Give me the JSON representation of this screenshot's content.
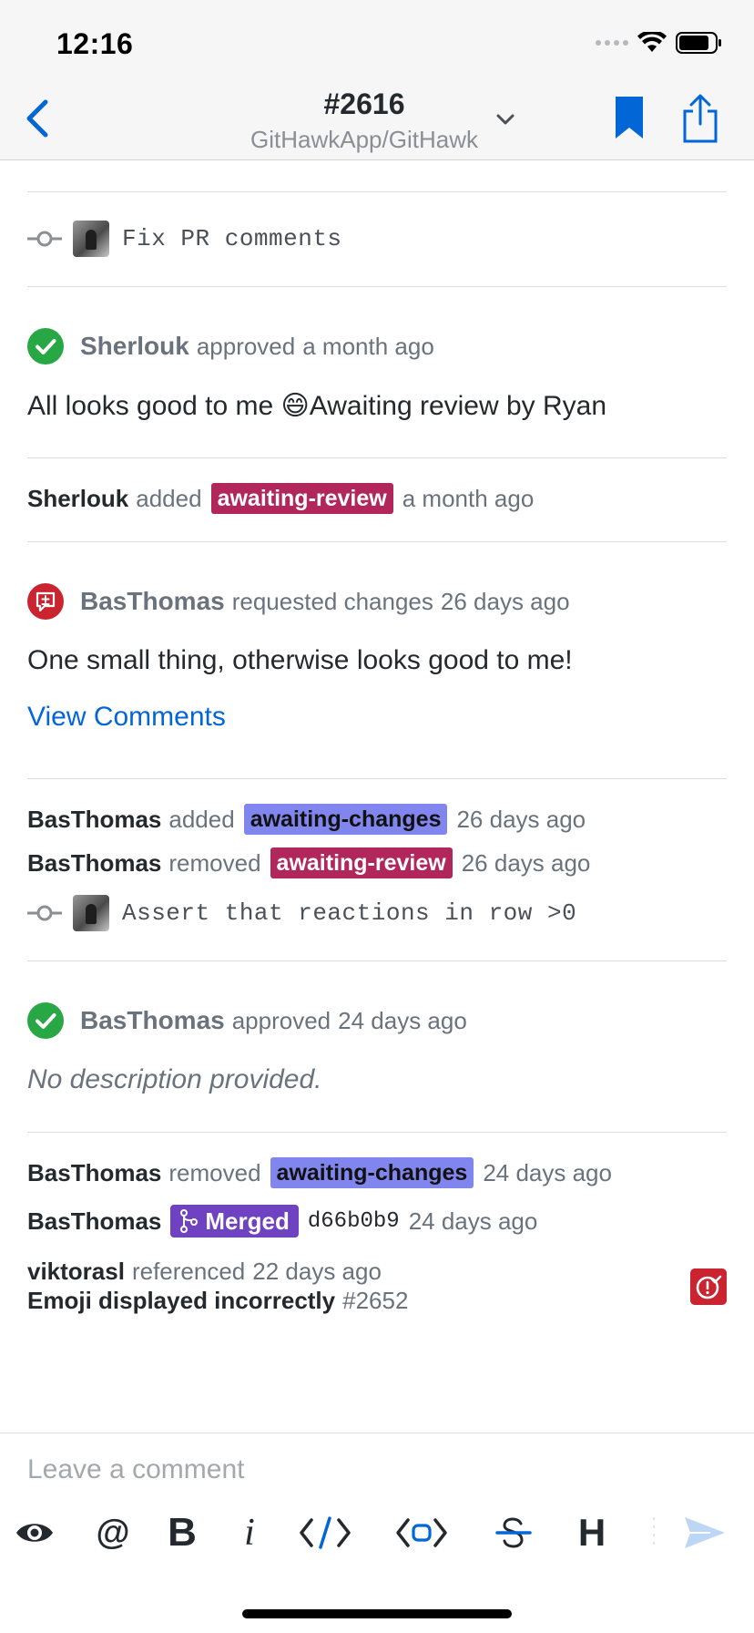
{
  "status_bar": {
    "time": "12:16"
  },
  "nav": {
    "title": "#2616",
    "subtitle": "GitHawkApp/GitHawk"
  },
  "feed": {
    "commit1": {
      "message": "Fix PR comments"
    },
    "review1": {
      "user": "Sherlouk",
      "action": "approved",
      "time": "a month ago",
      "body_before": "All looks good to me",
      "emoji": "😄",
      "body_after": "Awaiting review by Ryan"
    },
    "label_event1": {
      "user": "Sherlouk",
      "action": "added",
      "label": "awaiting-review",
      "time": "a month ago"
    },
    "review2": {
      "user": "BasThomas",
      "action": "requested changes",
      "time": "26 days ago",
      "body": "One small thing, otherwise looks good to me!",
      "link": "View Comments"
    },
    "label_event2": {
      "user": "BasThomas",
      "action": "added",
      "label": "awaiting-changes",
      "time": "26 days ago"
    },
    "label_event3": {
      "user": "BasThomas",
      "action": "removed",
      "label": "awaiting-review",
      "time": "26 days ago"
    },
    "commit2": {
      "message": "Assert that reactions in row >0"
    },
    "review3": {
      "user": "BasThomas",
      "action": "approved",
      "time": "24 days ago",
      "body": "No description provided."
    },
    "label_event4": {
      "user": "BasThomas",
      "action": "removed",
      "label": "awaiting-changes",
      "time": "24 days ago"
    },
    "merge_event": {
      "user": "BasThomas",
      "badge": "Merged",
      "sha": "d66b0b9",
      "time": "24 days ago"
    },
    "reference_event": {
      "user": "viktorasl",
      "action": "referenced",
      "time": "22 days ago",
      "issue_title": "Emoji displayed incorrectly",
      "issue_number": "#2652"
    }
  },
  "composer": {
    "placeholder": "Leave a comment",
    "toolbar": [
      "preview-icon",
      "mention-icon",
      "bold-icon",
      "italic-icon",
      "code-icon",
      "code-block-icon",
      "strikethrough-icon",
      "header-icon",
      "send-icon"
    ],
    "toolbar_text": {
      "mention": "@",
      "bold": "B",
      "italic": "i",
      "header": "H"
    }
  },
  "colors": {
    "accent": "#0366d6",
    "approved": "#28a745",
    "changes_requested": "#cb2431",
    "merged": "#6f42c1",
    "label_awaiting_review": "#b1275c",
    "label_awaiting_changes": "#8186ee"
  }
}
